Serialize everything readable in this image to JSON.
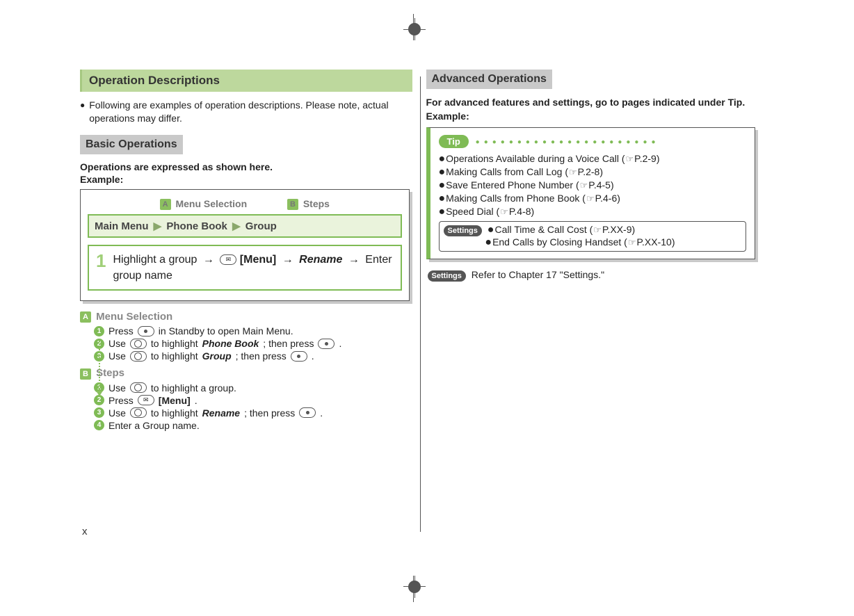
{
  "left": {
    "title": "Operation Descriptions",
    "intro": "Following are examples of operation descriptions. Please note, actual operations may differ.",
    "basic_title": "Basic Operations",
    "basic_lead": "Operations are expressed as shown here.",
    "example_label": "Example:",
    "callout_a": "Menu Selection",
    "callout_b": "Steps",
    "menubar": {
      "a": "Main Menu",
      "b": "Phone Book",
      "c": "Group"
    },
    "step_num": "1",
    "step_text_1": "Highlight a group",
    "step_menu": "[Menu]",
    "step_rename": "Rename",
    "step_text_2": "Enter group name",
    "explA_title": "Menu Selection",
    "a1_a": "Press",
    "a1_b": "in Standby to open Main Menu.",
    "a2_a": "Use",
    "a2_b": "to highlight",
    "a2_c": "Phone Book",
    "a2_d": "; then press",
    "a2_e": ".",
    "a3_a": "Use",
    "a3_b": "to highlight",
    "a3_c": "Group",
    "a3_d": "; then press",
    "a3_e": ".",
    "explB_title": "Steps",
    "b1_a": "Use",
    "b1_b": "to highlight a group.",
    "b2_a": "Press",
    "b2_b": "[Menu]",
    "b2_c": ".",
    "b3_a": "Use",
    "b3_b": "to highlight",
    "b3_c": "Rename",
    "b3_d": "; then press",
    "b3_e": ".",
    "b4": "Enter a Group name."
  },
  "right": {
    "title": "Advanced Operations",
    "lead": "For advanced features and settings, go to pages indicated under Tip.",
    "example_label": "Example:",
    "tip_label": "Tip",
    "tips": [
      {
        "t": "Operations Available during a Voice Call (",
        "p": "P.2-9",
        "e": ")"
      },
      {
        "t": "Making Calls from Call Log (",
        "p": "P.2-8",
        "e": ")"
      },
      {
        "t": "Save Entered Phone Number (",
        "p": "P.4-5",
        "e": ")"
      },
      {
        "t": "Making Calls from Phone Book (",
        "p": "P.4-6",
        "e": ")"
      },
      {
        "t": "Speed Dial (",
        "p": "P.4-8",
        "e": ")"
      }
    ],
    "settings_label": "Settings",
    "setting_items": [
      {
        "t": "Call Time & Call Cost (",
        "p": "P.XX-9",
        "e": ")"
      },
      {
        "t": "End Calls by Closing Handset (",
        "p": "P.XX-10",
        "e": ")"
      }
    ],
    "settings_ref": "Refer to Chapter 17 \"Settings.\""
  },
  "page_number": "x"
}
